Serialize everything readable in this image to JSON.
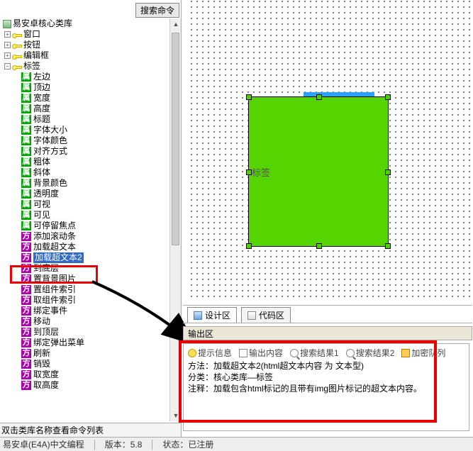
{
  "search_btn": "搜索命令",
  "library_title": "易安卓核心类库",
  "top_nodes": [
    "窗口",
    "按钮",
    "编辑框",
    "标签"
  ],
  "props_shu": [
    "左边",
    "顶边",
    "宽度",
    "高度",
    "标题",
    "字体大小",
    "字体颜色",
    "对齐方式",
    "粗体",
    "斜体",
    "背景颜色",
    "透明度",
    "可视",
    "可见",
    "可停留焦点"
  ],
  "props_fang": [
    "添加滚动条",
    "加载超文本",
    "加载超文本2",
    "到底层",
    "置背景图片",
    "置组件索引",
    "取组件索引",
    "绑定事件",
    "移动",
    "到顶层",
    "绑定弹出菜单",
    "刷新",
    "销毁",
    "取宽度",
    "取高度"
  ],
  "selected_index": 2,
  "left_footer": "双击类库名称查看命令列表",
  "design_tabs": {
    "design": "设计区",
    "code": "代码区"
  },
  "widget_label": "标签",
  "output_title": "输出区",
  "out_tabs": {
    "hint": "提示信息",
    "content": "输出内容",
    "res1": "搜索结果1",
    "res2": "搜索结果2",
    "enc": "加密队列"
  },
  "output_lines": {
    "l1": "方法：加载超文本2(html超文本内容 为 文本型)",
    "l2": "分类：核心类库—标签",
    "l3": "注释：加载包含html标记的且带有img图片标记的超文本内容。"
  },
  "status": {
    "s1": "易安卓(E4A)中文编程",
    "s2": "版本：5.8",
    "s3": "状态：已注册"
  }
}
